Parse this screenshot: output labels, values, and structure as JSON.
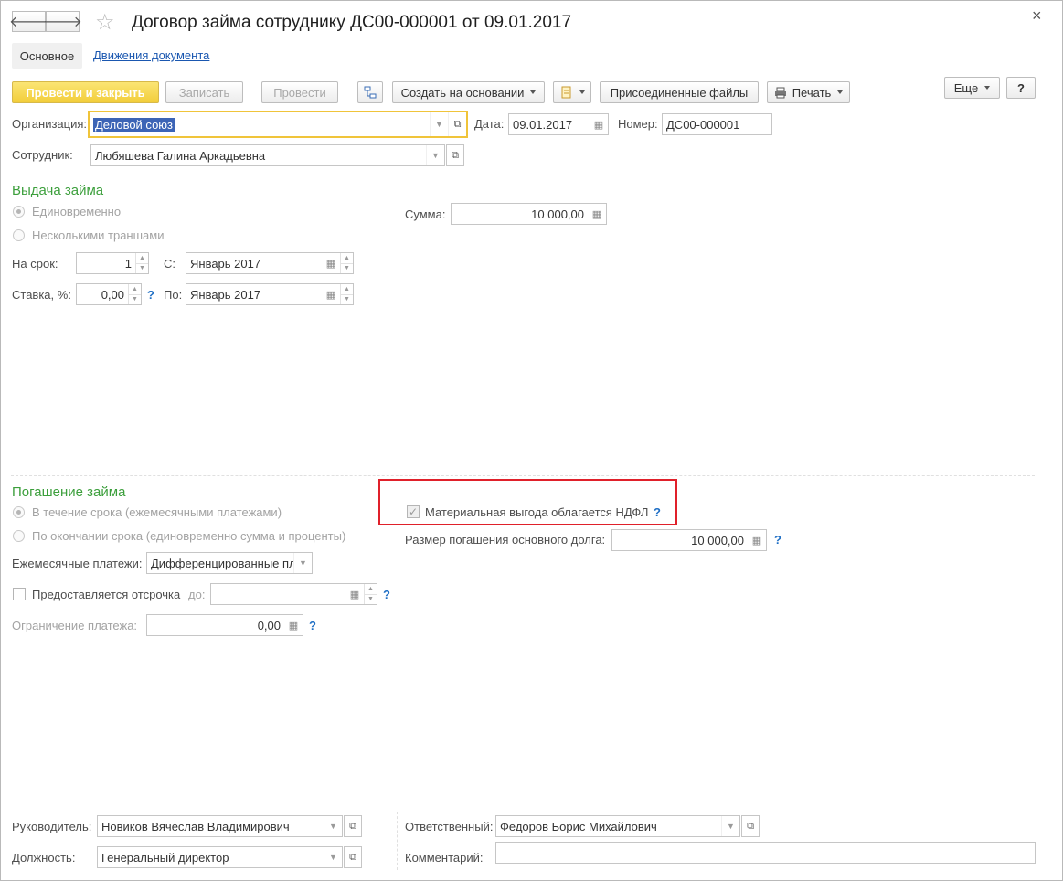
{
  "window": {
    "title": "Договор займа сотруднику ДС00-000001 от 09.01.2017",
    "close_glyph": "×"
  },
  "nav": {
    "back_glyph": "🡐",
    "forward_glyph": "🡒",
    "star_glyph": "☆"
  },
  "tabs": {
    "main": "Основное",
    "movements": "Движения документа"
  },
  "toolbar": {
    "post_close": "Провести и закрыть",
    "save": "Записать",
    "post": "Провести",
    "create_based": "Создать на основании",
    "attached_files": "Присоединенные файлы",
    "print": "Печать",
    "more": "Еще",
    "help": "?"
  },
  "header": {
    "org_label": "Организация:",
    "org_value": "Деловой союз",
    "date_label": "Дата:",
    "date_value": "09.01.2017",
    "number_label": "Номер:",
    "number_value": "ДС00-000001",
    "employee_label": "Сотрудник:",
    "employee_value": "Любяшева Галина Аркадьевна"
  },
  "issue": {
    "title": "Выдача займа",
    "once": "Единовременно",
    "tranches": "Несколькими траншами",
    "sum_label": "Сумма:",
    "sum_value": "10 000,00",
    "term_label": "На срок:",
    "term_value": "1",
    "from_label": "С:",
    "from_value": "Январь 2017",
    "rate_label": "Ставка, %:",
    "rate_value": "0,00",
    "to_label": "По:",
    "to_value": "Январь 2017",
    "help": "?"
  },
  "repayment": {
    "title": "Погашение займа",
    "monthly_option": "В течение срока (ежемесячными платежами)",
    "end_option": "По окончании срока (единовременно сумма и проценты)",
    "benefit_label": "Материальная выгода облагается НДФЛ",
    "debt_label": "Размер погашения основного долга:",
    "debt_value": "10 000,00",
    "payments_label": "Ежемесячные платежи:",
    "payments_value": "Дифференцированные пла",
    "deferral_label": "Предоставляется отсрочка",
    "until_label": "до:",
    "until_value": "",
    "limit_label": "Ограничение платежа:",
    "limit_value": "0,00",
    "help": "?"
  },
  "footer": {
    "head_label": "Руководитель:",
    "head_value": "Новиков Вячеслав Владимирович",
    "position_label": "Должность:",
    "position_value": "Генеральный директор",
    "responsible_label": "Ответственный:",
    "responsible_value": "Федоров Борис Михайлович",
    "comment_label": "Комментарий:",
    "comment_value": ""
  },
  "colors": {
    "section_green": "#3c9f3c",
    "primary_yellow": "#f2cd3a",
    "highlight_red": "#e0202a",
    "selection_blue": "#3c64b6"
  }
}
